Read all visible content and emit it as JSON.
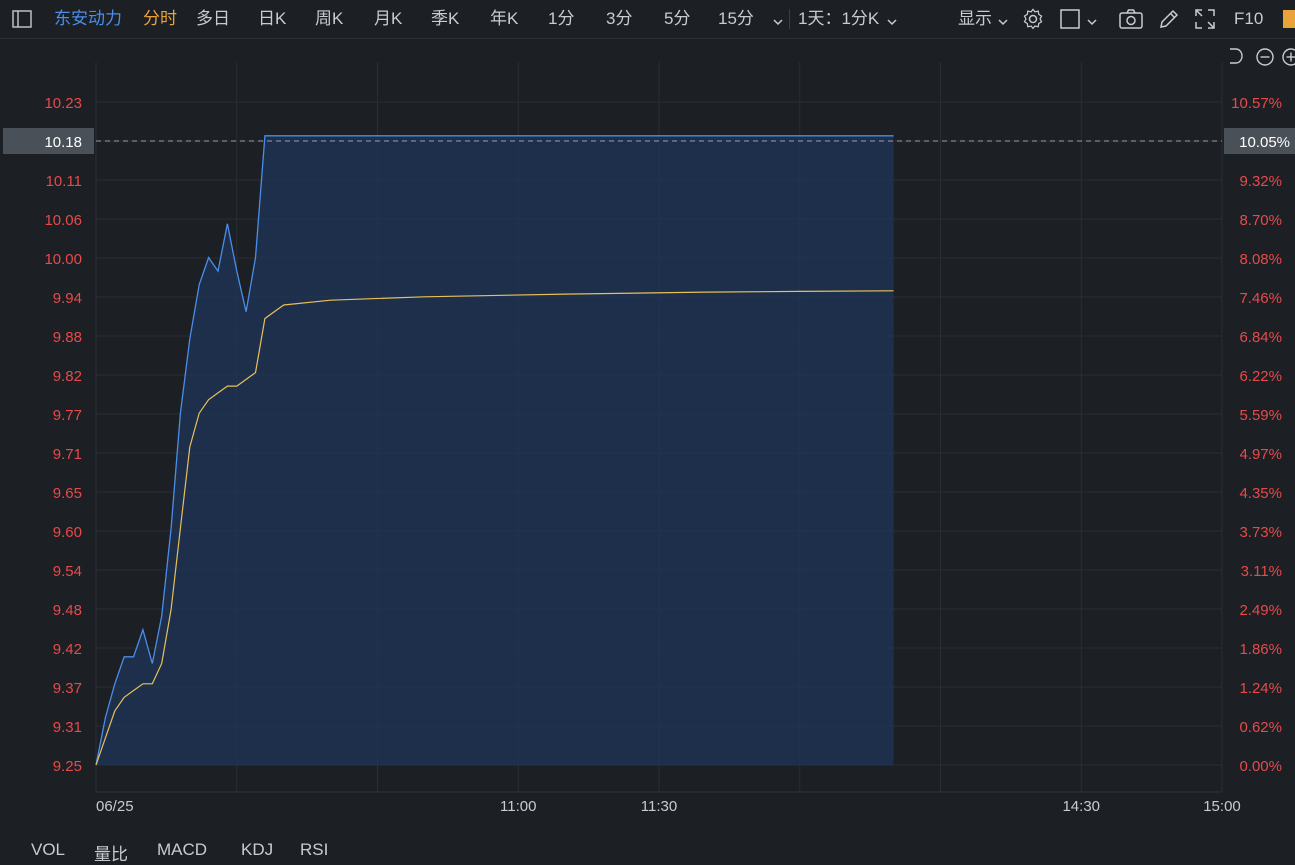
{
  "toolbar": {
    "symbol": "东安动力",
    "tabs": [
      "分时",
      "多日",
      "日K",
      "周K",
      "月K",
      "季K",
      "年K",
      "1分",
      "3分",
      "5分",
      "15分"
    ],
    "period_select": "1天：1分K",
    "display_label": "显示",
    "f10_label": "F10"
  },
  "chart_data": {
    "type": "line",
    "date_label": "06/25",
    "x_ticks": [
      "11:00",
      "11:30",
      "14:30",
      "15:00"
    ],
    "y_ticks_left": [
      "10.23",
      "10.18",
      "10.11",
      "10.06",
      "10.00",
      "9.94",
      "9.88",
      "9.82",
      "9.77",
      "9.71",
      "9.65",
      "9.60",
      "9.54",
      "9.48",
      "9.42",
      "9.37",
      "9.31",
      "9.25"
    ],
    "y_ticks_right": [
      "10.57%",
      "10.05%",
      "9.32%",
      "8.70%",
      "8.08%",
      "7.46%",
      "6.84%",
      "6.22%",
      "5.59%",
      "4.97%",
      "4.35%",
      "3.73%",
      "3.11%",
      "2.49%",
      "1.86%",
      "1.24%",
      "0.62%",
      "0.00%"
    ],
    "ylim": [
      9.25,
      10.23
    ],
    "current_price": "10.18",
    "current_pct": "10.05%",
    "price_color": "#4a8ee8",
    "avg_color": "#e8c05a",
    "axis_label_color": "#e84a4a",
    "series": [
      {
        "values": [
          [
            0,
            9.25
          ],
          [
            2,
            9.32
          ],
          [
            4,
            9.37
          ],
          [
            6,
            9.41
          ],
          [
            8,
            9.41
          ],
          [
            10,
            9.45
          ],
          [
            12,
            9.4
          ],
          [
            14,
            9.47
          ],
          [
            16,
            9.6
          ],
          [
            18,
            9.77
          ],
          [
            20,
            9.88
          ],
          [
            22,
            9.96
          ],
          [
            24,
            10.0
          ],
          [
            26,
            9.98
          ],
          [
            28,
            10.05
          ],
          [
            30,
            9.98
          ],
          [
            32,
            9.92
          ],
          [
            34,
            10.0
          ],
          [
            36,
            10.18
          ],
          [
            46,
            10.18
          ],
          [
            100,
            10.18
          ],
          [
            150,
            10.18
          ],
          [
            170,
            10.18
          ]
        ]
      },
      {
        "values": [
          [
            0,
            9.25
          ],
          [
            4,
            9.33
          ],
          [
            6,
            9.35
          ],
          [
            10,
            9.37
          ],
          [
            12,
            9.37
          ],
          [
            14,
            9.4
          ],
          [
            16,
            9.48
          ],
          [
            18,
            9.6
          ],
          [
            20,
            9.72
          ],
          [
            22,
            9.77
          ],
          [
            24,
            9.79
          ],
          [
            26,
            9.8
          ],
          [
            28,
            9.81
          ],
          [
            30,
            9.81
          ],
          [
            32,
            9.82
          ],
          [
            34,
            9.83
          ],
          [
            36,
            9.91
          ],
          [
            40,
            9.93
          ],
          [
            50,
            9.937
          ],
          [
            70,
            9.942
          ],
          [
            100,
            9.946
          ],
          [
            130,
            9.949
          ],
          [
            150,
            9.95
          ],
          [
            170,
            9.951
          ]
        ]
      }
    ]
  },
  "bottom_tabs": [
    "VOL",
    "量比",
    "MACD",
    "KDJ",
    "RSI"
  ]
}
